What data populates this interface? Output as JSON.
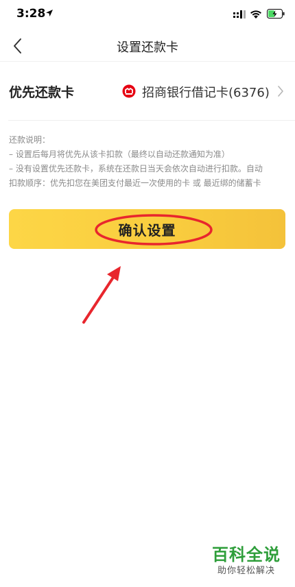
{
  "status_bar": {
    "time": "3:28"
  },
  "nav": {
    "title": "设置还款卡"
  },
  "card_row": {
    "label": "优先还款卡",
    "value": "招商银行借记卡(6376)",
    "bank_icon": "cmb-bank-logo-icon",
    "bank_color": "#e60012"
  },
  "notes": {
    "heading": "还款说明：",
    "line1": "– 设置后每月将优先从该卡扣款（最终以自动还款通知为准）",
    "line2": "– 没有设置优先还款卡，系统在还款日当天会依次自动进行扣款。自动",
    "line3": "扣款顺序：优先扣您在美团支付最近一次使用的卡 或 最近绑的储蓄卡"
  },
  "confirm_button": {
    "label": "确认设置",
    "color": "#f9cc3e"
  },
  "annotation": {
    "color": "#e8262d"
  },
  "watermark": {
    "main": "百科全说",
    "sub": "助你轻松解决"
  }
}
